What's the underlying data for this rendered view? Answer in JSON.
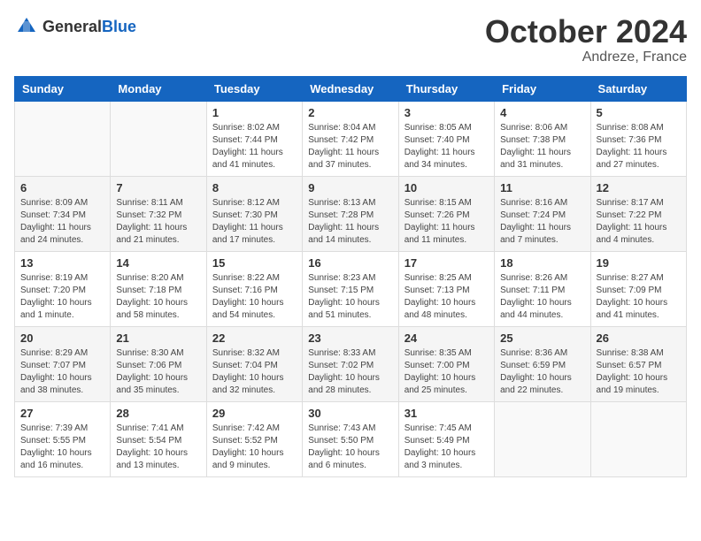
{
  "header": {
    "logo_general": "General",
    "logo_blue": "Blue",
    "month_title": "October 2024",
    "location": "Andreze, France"
  },
  "calendar": {
    "days_of_week": [
      "Sunday",
      "Monday",
      "Tuesday",
      "Wednesday",
      "Thursday",
      "Friday",
      "Saturday"
    ],
    "weeks": [
      [
        {
          "day": "",
          "info": ""
        },
        {
          "day": "",
          "info": ""
        },
        {
          "day": "1",
          "info": "Sunrise: 8:02 AM\nSunset: 7:44 PM\nDaylight: 11 hours and 41 minutes."
        },
        {
          "day": "2",
          "info": "Sunrise: 8:04 AM\nSunset: 7:42 PM\nDaylight: 11 hours and 37 minutes."
        },
        {
          "day": "3",
          "info": "Sunrise: 8:05 AM\nSunset: 7:40 PM\nDaylight: 11 hours and 34 minutes."
        },
        {
          "day": "4",
          "info": "Sunrise: 8:06 AM\nSunset: 7:38 PM\nDaylight: 11 hours and 31 minutes."
        },
        {
          "day": "5",
          "info": "Sunrise: 8:08 AM\nSunset: 7:36 PM\nDaylight: 11 hours and 27 minutes."
        }
      ],
      [
        {
          "day": "6",
          "info": "Sunrise: 8:09 AM\nSunset: 7:34 PM\nDaylight: 11 hours and 24 minutes."
        },
        {
          "day": "7",
          "info": "Sunrise: 8:11 AM\nSunset: 7:32 PM\nDaylight: 11 hours and 21 minutes."
        },
        {
          "day": "8",
          "info": "Sunrise: 8:12 AM\nSunset: 7:30 PM\nDaylight: 11 hours and 17 minutes."
        },
        {
          "day": "9",
          "info": "Sunrise: 8:13 AM\nSunset: 7:28 PM\nDaylight: 11 hours and 14 minutes."
        },
        {
          "day": "10",
          "info": "Sunrise: 8:15 AM\nSunset: 7:26 PM\nDaylight: 11 hours and 11 minutes."
        },
        {
          "day": "11",
          "info": "Sunrise: 8:16 AM\nSunset: 7:24 PM\nDaylight: 11 hours and 7 minutes."
        },
        {
          "day": "12",
          "info": "Sunrise: 8:17 AM\nSunset: 7:22 PM\nDaylight: 11 hours and 4 minutes."
        }
      ],
      [
        {
          "day": "13",
          "info": "Sunrise: 8:19 AM\nSunset: 7:20 PM\nDaylight: 10 hours and 1 minute."
        },
        {
          "day": "14",
          "info": "Sunrise: 8:20 AM\nSunset: 7:18 PM\nDaylight: 10 hours and 58 minutes."
        },
        {
          "day": "15",
          "info": "Sunrise: 8:22 AM\nSunset: 7:16 PM\nDaylight: 10 hours and 54 minutes."
        },
        {
          "day": "16",
          "info": "Sunrise: 8:23 AM\nSunset: 7:15 PM\nDaylight: 10 hours and 51 minutes."
        },
        {
          "day": "17",
          "info": "Sunrise: 8:25 AM\nSunset: 7:13 PM\nDaylight: 10 hours and 48 minutes."
        },
        {
          "day": "18",
          "info": "Sunrise: 8:26 AM\nSunset: 7:11 PM\nDaylight: 10 hours and 44 minutes."
        },
        {
          "day": "19",
          "info": "Sunrise: 8:27 AM\nSunset: 7:09 PM\nDaylight: 10 hours and 41 minutes."
        }
      ],
      [
        {
          "day": "20",
          "info": "Sunrise: 8:29 AM\nSunset: 7:07 PM\nDaylight: 10 hours and 38 minutes."
        },
        {
          "day": "21",
          "info": "Sunrise: 8:30 AM\nSunset: 7:06 PM\nDaylight: 10 hours and 35 minutes."
        },
        {
          "day": "22",
          "info": "Sunrise: 8:32 AM\nSunset: 7:04 PM\nDaylight: 10 hours and 32 minutes."
        },
        {
          "day": "23",
          "info": "Sunrise: 8:33 AM\nSunset: 7:02 PM\nDaylight: 10 hours and 28 minutes."
        },
        {
          "day": "24",
          "info": "Sunrise: 8:35 AM\nSunset: 7:00 PM\nDaylight: 10 hours and 25 minutes."
        },
        {
          "day": "25",
          "info": "Sunrise: 8:36 AM\nSunset: 6:59 PM\nDaylight: 10 hours and 22 minutes."
        },
        {
          "day": "26",
          "info": "Sunrise: 8:38 AM\nSunset: 6:57 PM\nDaylight: 10 hours and 19 minutes."
        }
      ],
      [
        {
          "day": "27",
          "info": "Sunrise: 7:39 AM\nSunset: 5:55 PM\nDaylight: 10 hours and 16 minutes."
        },
        {
          "day": "28",
          "info": "Sunrise: 7:41 AM\nSunset: 5:54 PM\nDaylight: 10 hours and 13 minutes."
        },
        {
          "day": "29",
          "info": "Sunrise: 7:42 AM\nSunset: 5:52 PM\nDaylight: 10 hours and 9 minutes."
        },
        {
          "day": "30",
          "info": "Sunrise: 7:43 AM\nSunset: 5:50 PM\nDaylight: 10 hours and 6 minutes."
        },
        {
          "day": "31",
          "info": "Sunrise: 7:45 AM\nSunset: 5:49 PM\nDaylight: 10 hours and 3 minutes."
        },
        {
          "day": "",
          "info": ""
        },
        {
          "day": "",
          "info": ""
        }
      ]
    ]
  }
}
